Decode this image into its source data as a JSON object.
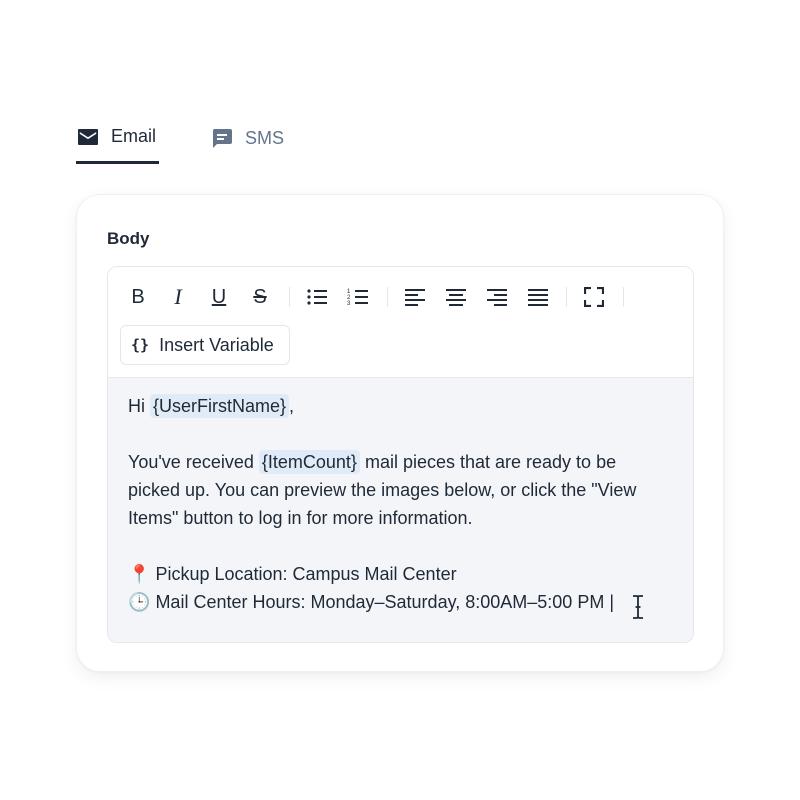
{
  "tabs": [
    {
      "label": "Email",
      "icon": "envelope-icon",
      "active": true
    },
    {
      "label": "SMS",
      "icon": "chat-icon",
      "active": false
    }
  ],
  "card": {
    "body_label": "Body"
  },
  "toolbar": {
    "buttons": [
      "bold-icon",
      "italic-icon",
      "underline-icon",
      "strikethrough-icon",
      "bulleted-list-icon",
      "numbered-list-icon",
      "align-left-icon",
      "align-center-icon",
      "align-right-icon",
      "align-justify-icon",
      "fullscreen-icon"
    ],
    "bold": "B",
    "italic": "I",
    "underline": "U",
    "strike": "S",
    "insert_variable_braces": "{}",
    "insert_variable_label": "Insert Variable"
  },
  "content": {
    "line1_prefix": "Hi",
    "line1_var": "{UserFirstName}",
    "line1_suffix": ",",
    "line2_prefix": "You've received",
    "line2_var": "{ItemCount}",
    "line2_suffix": "mail pieces that are ready to be",
    "line3": "picked up. You can preview the images below, or click the \"View",
    "line4": "Items\" button to log in for more information.",
    "location_emoji": "📍",
    "location_text": "Pickup Location: Campus Mail Center",
    "hours_emoji": "🕒",
    "hours_text": "Mail Center Hours: Monday–Saturday, 8:00AM–5:00 PM |"
  },
  "colors": {
    "text": "#1f2937",
    "muted": "#64748b",
    "variable_bg": "#e0ebf7",
    "editor_bg": "#f3f5f8"
  }
}
